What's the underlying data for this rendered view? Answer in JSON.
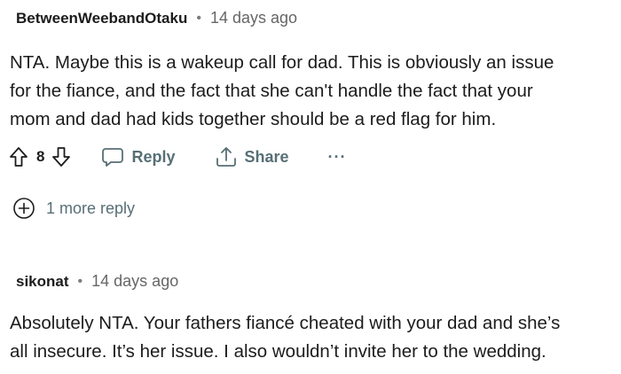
{
  "comments": [
    {
      "author": "BetweenWeebandOtaku",
      "separator": "•",
      "time": "14 days ago",
      "body_lines": [
        "NTA. Maybe this is a wakeup call for dad. This is obviously an issue",
        "for the fiance, and the fact that she can't handle the fact that your",
        "mom and dad had kids together should be a red flag for him."
      ],
      "score": "8",
      "reply_label": "Reply",
      "share_label": "Share",
      "more_label": "···",
      "more_replies_label": "1 more reply"
    },
    {
      "author": "sikonat",
      "separator": "•",
      "time": "14 days ago",
      "body_lines": [
        "Absolutely NTA. Your fathers fiancé cheated with your dad and she’s",
        "all insecure. It’s her issue. I also wouldn’t invite her to the wedding."
      ]
    }
  ],
  "icons": {
    "upvote": "arrow-up-icon",
    "downvote": "arrow-down-icon",
    "reply": "speech-bubble-icon",
    "share": "share-upload-icon",
    "expand": "plus-circle-icon"
  },
  "colors": {
    "text": "#1c1c1c",
    "muted": "#576f76",
    "timestamp": "#666666"
  }
}
